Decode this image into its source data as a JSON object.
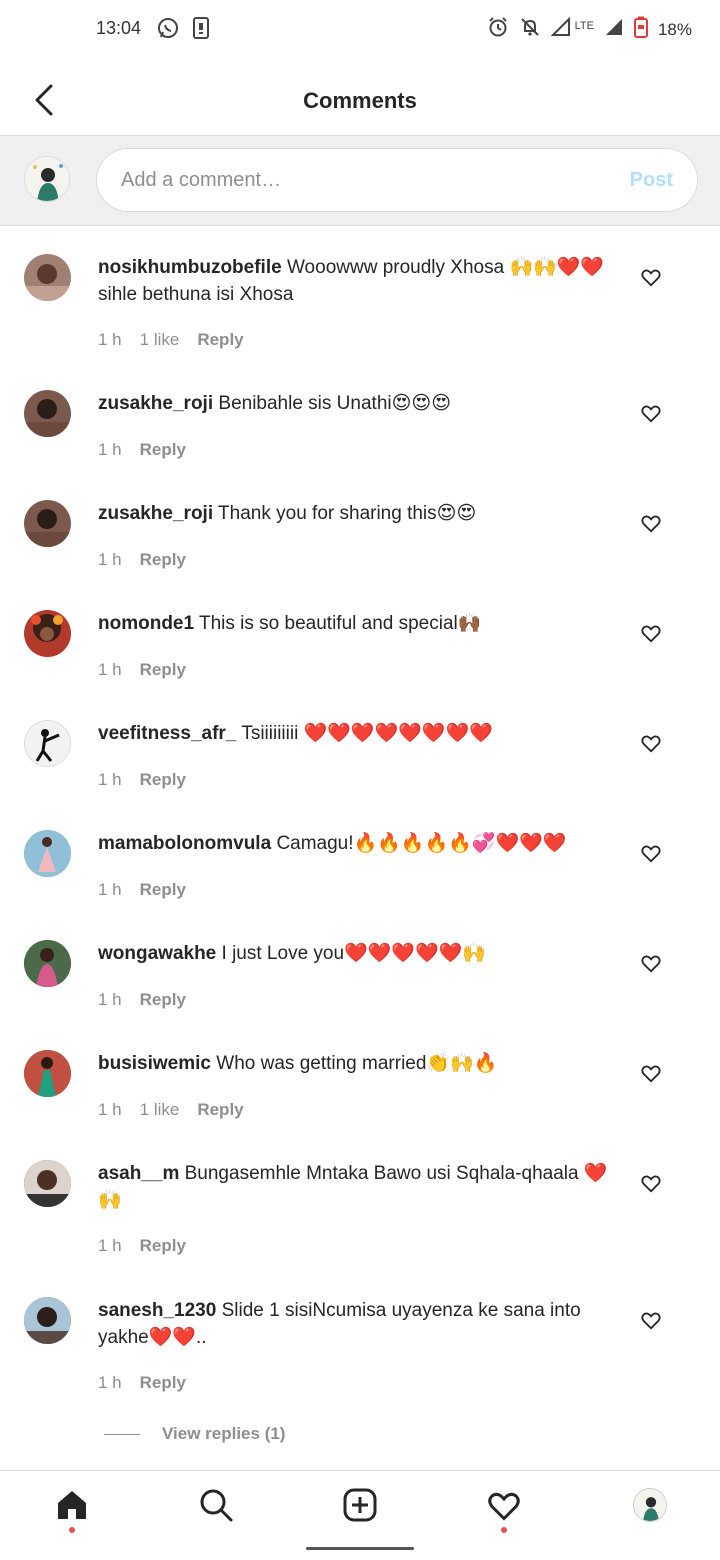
{
  "status_bar": {
    "time": "13:04",
    "left_icons": [
      "whatsapp-icon",
      "sim-card-icon"
    ],
    "right_icons": [
      "alarm-icon",
      "mute-icon",
      "signal-icon",
      "lte-icon",
      "signal-icon",
      "battery-low-icon"
    ],
    "lte_label": "LTE",
    "battery": "18%"
  },
  "header": {
    "title": "Comments",
    "back_icon": "back-arrow-icon"
  },
  "composer": {
    "placeholder": "Add a comment…",
    "post_label": "Post"
  },
  "comments": [
    {
      "user": "nosikhumbuzobefile",
      "text": "Wooowww proudly Xhosa 🙌🙌❤️❤️ sihle bethuna isi Xhosa",
      "time": "1 h",
      "likes": "1 like",
      "reply": "Reply",
      "avatar_color": "#a08070"
    },
    {
      "user": "zusakhe_roji",
      "text": "Benibahle sis Unathi😍😍😍",
      "time": "1 h",
      "likes": "",
      "reply": "Reply",
      "avatar_color": "#7b5a4d"
    },
    {
      "user": "zusakhe_roji",
      "text": "Thank you for sharing this😍😍",
      "time": "1 h",
      "likes": "",
      "reply": "Reply",
      "avatar_color": "#7b5a4d"
    },
    {
      "user": "nomonde1",
      "text": "This is so beautiful and special🙌🏾",
      "time": "1 h",
      "likes": "",
      "reply": "Reply",
      "avatar_color": "#b23a2a"
    },
    {
      "user": "veefitness_afr_",
      "text": "Tsiiiiiiiii ❤️❤️❤️❤️❤️❤️❤️❤️",
      "time": "1 h",
      "likes": "",
      "reply": "Reply",
      "avatar_color": "#f2f2f2"
    },
    {
      "user": "mamabolonomvula",
      "text": "Camagu!🔥🔥🔥🔥🔥💞❤️❤️❤️",
      "time": "1 h",
      "likes": "",
      "reply": "Reply",
      "avatar_color": "#d9a59a"
    },
    {
      "user": "wongawakhe",
      "text": "I just Love you❤️❤️❤️❤️❤️🙌",
      "time": "1 h",
      "likes": "",
      "reply": "Reply",
      "avatar_color": "#8a6a55"
    },
    {
      "user": "busisiwemic",
      "text": "Who was getting married👏🙌🔥",
      "time": "1 h",
      "likes": "1 like",
      "reply": "Reply",
      "avatar_color": "#3f8f6a"
    },
    {
      "user": "asah__m",
      "text": "Bungasemhle Mntaka Bawo usi Sqhala-qhaala ❤️🙌",
      "time": "1 h",
      "likes": "",
      "reply": "Reply",
      "avatar_color": "#4b3a33"
    },
    {
      "user": "sanesh_1230",
      "text": "Slide 1 sisiNcumisa uyayenza ke sana into yakhe❤️❤️..",
      "time": "1 h",
      "likes": "",
      "reply": "Reply",
      "avatar_color": "#6a5a55"
    }
  ],
  "view_replies": "View replies (1)",
  "bottom_nav": [
    "home-icon",
    "search-icon",
    "add-post-icon",
    "activity-heart-icon",
    "profile-avatar"
  ]
}
